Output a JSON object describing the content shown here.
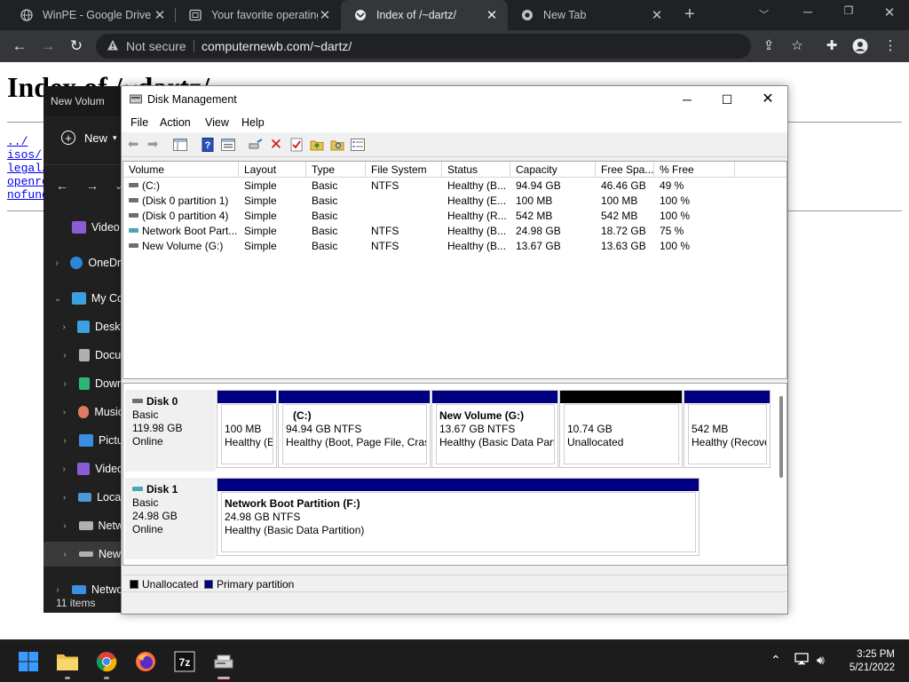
{
  "browser": {
    "tabs": [
      {
        "title": "WinPE - Google Drive",
        "active": false
      },
      {
        "title": "Your favorite operating",
        "active": false
      },
      {
        "title": "Index of /~dartz/",
        "active": true
      },
      {
        "title": "New Tab",
        "active": false
      }
    ],
    "new_tab_label": "+",
    "security_text": "Not secure",
    "url": "computernewb.com/~dartz/"
  },
  "webpage": {
    "heading": "Index of /~dartz/",
    "links": [
      "../",
      "isos/",
      "legal/",
      "openrc",
      "nofund"
    ]
  },
  "explorer": {
    "title": "New Volum",
    "new_label": "New",
    "items": [
      {
        "label": "Video",
        "color": "#8a5cd6"
      },
      {
        "label": "OneDri",
        "color": "#2b88d8"
      },
      {
        "label": "My Co",
        "color": "#3aa0e0"
      },
      {
        "label": "Deskt",
        "color": "#3aa0e0"
      },
      {
        "label": "Docu",
        "color": "#b0b0b0"
      },
      {
        "label": "Down",
        "color": "#2fb57a"
      },
      {
        "label": "Music",
        "color": "#e07a5f"
      },
      {
        "label": "Pictu",
        "color": "#3a8fe0"
      },
      {
        "label": "Video",
        "color": "#8a5cd6"
      },
      {
        "label": "Local",
        "color": "#4a9ad8"
      },
      {
        "label": "Netw",
        "color": "#b0b0b0"
      },
      {
        "label": "New",
        "color": "#b0b0b0"
      },
      {
        "label": "Netwo",
        "color": "#3a8fe0"
      }
    ],
    "status": "11 items"
  },
  "disk_management": {
    "title": "Disk Management",
    "menu": [
      "File",
      "Action",
      "View",
      "Help"
    ],
    "columns": [
      "Volume",
      "Layout",
      "Type",
      "File System",
      "Status",
      "Capacity",
      "Free Spa...",
      "% Free"
    ],
    "volumes": [
      {
        "volume": "(C:)",
        "layout": "Simple",
        "type": "Basic",
        "fs": "NTFS",
        "status": "Healthy (B...",
        "capacity": "94.94 GB",
        "free": "46.46 GB",
        "pct": "49 %",
        "icon": "drive"
      },
      {
        "volume": "(Disk 0 partition 1)",
        "layout": "Simple",
        "type": "Basic",
        "fs": "",
        "status": "Healthy (E...",
        "capacity": "100 MB",
        "free": "100 MB",
        "pct": "100 %",
        "icon": "drive"
      },
      {
        "volume": "(Disk 0 partition 4)",
        "layout": "Simple",
        "type": "Basic",
        "fs": "",
        "status": "Healthy (R...",
        "capacity": "542 MB",
        "free": "542 MB",
        "pct": "100 %",
        "icon": "drive"
      },
      {
        "volume": "Network Boot Part...",
        "layout": "Simple",
        "type": "Basic",
        "fs": "NTFS",
        "status": "Healthy (B...",
        "capacity": "24.98 GB",
        "free": "18.72 GB",
        "pct": "75 %",
        "icon": "network"
      },
      {
        "volume": "New Volume (G:)",
        "layout": "Simple",
        "type": "Basic",
        "fs": "NTFS",
        "status": "Healthy (B...",
        "capacity": "13.67 GB",
        "free": "13.63 GB",
        "pct": "100 %",
        "icon": "drive"
      }
    ],
    "disks": [
      {
        "name": "Disk 0",
        "type": "Basic",
        "size": "119.98 GB",
        "state": "Online",
        "partitions": [
          {
            "name": "",
            "size": "100 MB",
            "status": "Healthy (E",
            "kind": "primary"
          },
          {
            "name": "(C:)",
            "size": "94.94 GB NTFS",
            "status": "Healthy (Boot, Page File, Crash",
            "kind": "primary"
          },
          {
            "name": "New Volume  (G:)",
            "size": "13.67 GB NTFS",
            "status": "Healthy (Basic Data Parti",
            "kind": "primary"
          },
          {
            "name": "",
            "size": "10.74 GB",
            "status": "Unallocated",
            "kind": "unallocated"
          },
          {
            "name": "",
            "size": "542 MB",
            "status": "Healthy (Recove",
            "kind": "primary"
          }
        ]
      },
      {
        "name": "Disk 1",
        "type": "Basic",
        "size": "24.98 GB",
        "state": "Online",
        "partitions": [
          {
            "name": "Network Boot Partition  (F:)",
            "size": "24.98 GB NTFS",
            "status": "Healthy (Basic Data Partition)",
            "kind": "primary"
          }
        ]
      }
    ],
    "legend": [
      {
        "label": "Unallocated",
        "color": "#000000"
      },
      {
        "label": "Primary partition",
        "color": "#000080"
      }
    ]
  },
  "taskbar": {
    "time": "3:25 PM",
    "date": "5/21/2022",
    "apps": [
      "start-icon",
      "file-explorer-icon",
      "chrome-icon",
      "firefox-icon",
      "7zip-icon",
      "disk-management-icon"
    ]
  },
  "colors": {
    "primary_partition": "#000080",
    "unallocated": "#000000",
    "chrome_dark": "#202124",
    "chrome_toolbar": "#35363a"
  }
}
